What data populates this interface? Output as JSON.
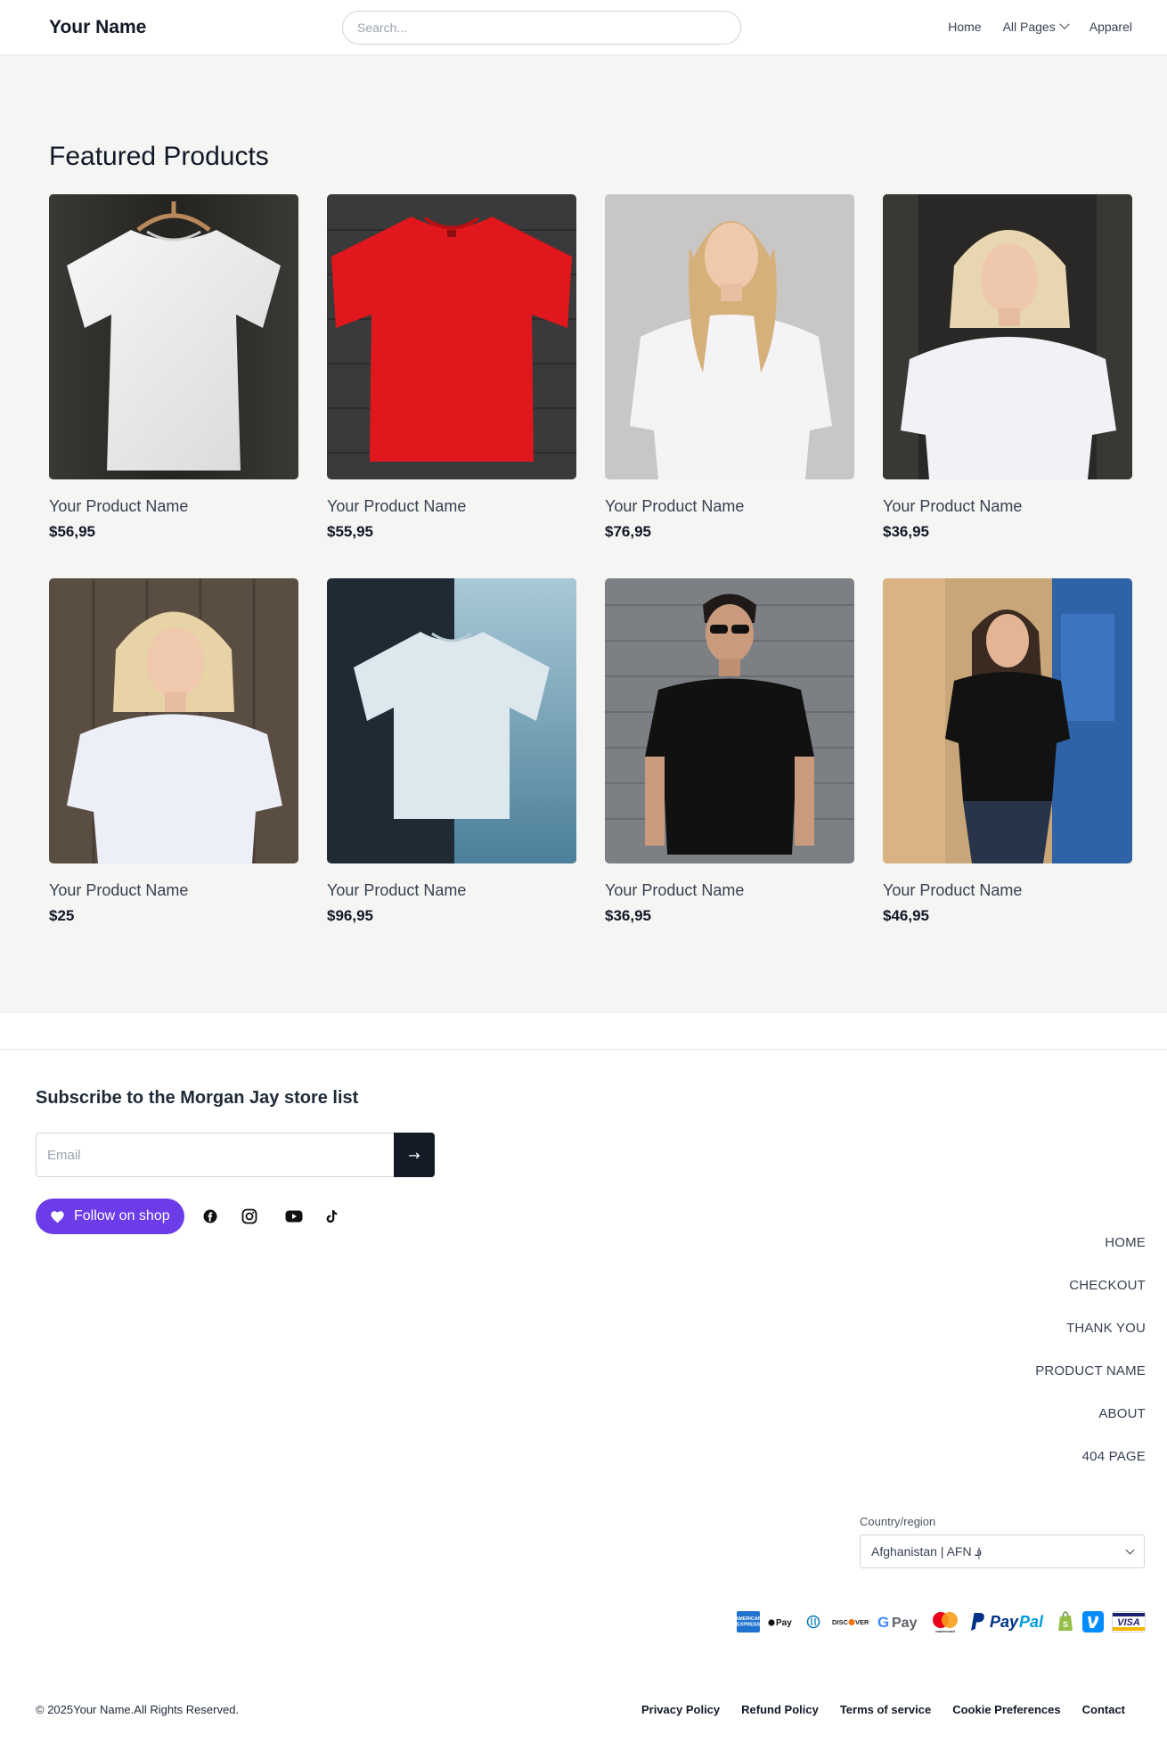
{
  "header": {
    "brand": "Your Name",
    "search_placeholder": "Search...",
    "nav": [
      {
        "label": "Home"
      },
      {
        "label": "All Pages"
      },
      {
        "label": "Apparel"
      }
    ]
  },
  "featured": {
    "title": "Featured Products",
    "products": [
      {
        "name": "Your Product Name",
        "price": "$56,95",
        "image": "white-tshirt-on-hanger"
      },
      {
        "name": "Your Product Name",
        "price": "$55,95",
        "image": "red-tshirt-flatlay"
      },
      {
        "name": "Your Product Name",
        "price": "$76,95",
        "image": "woman-white-tshirt"
      },
      {
        "name": "Your Product Name",
        "price": "$36,95",
        "image": "blonde-woman-white-tshirt"
      },
      {
        "name": "Your Product Name",
        "price": "$25",
        "image": "blonde-woman-white-tshirt-2"
      },
      {
        "name": "Your Product Name",
        "price": "$96,95",
        "image": "light-blue-tshirt-floating"
      },
      {
        "name": "Your Product Name",
        "price": "$36,95",
        "image": "man-black-tshirt-sunglasses"
      },
      {
        "name": "Your Product Name",
        "price": "$46,95",
        "image": "woman-black-tshirt-jeans"
      }
    ]
  },
  "footer": {
    "subscribe_title": "Subscribe to the Morgan Jay store list",
    "email_placeholder": "Email",
    "submit_symbol": "→",
    "follow_label": "Follow on shop",
    "socials": [
      "facebook-icon",
      "instagram-icon",
      "youtube-icon",
      "tiktok-icon"
    ],
    "nav": [
      {
        "label": "HOME"
      },
      {
        "label": "CHECKOUT"
      },
      {
        "label": "THANK YOU"
      },
      {
        "label": "PRODUCT NAME"
      },
      {
        "label": "ABOUT"
      },
      {
        "label": "404 PAGE"
      }
    ],
    "country_label": "Country/region",
    "country_value": "Afghanistan | AFN ؋",
    "payments": [
      "American Express",
      "Apple Pay",
      "Diners Club",
      "Discover",
      "Google Pay",
      "Mastercard",
      "PayPal",
      "Shop Pay",
      "Venmo",
      "Visa"
    ],
    "copyright": "© 2025Your Name.All Rights Reserved.",
    "legal": [
      {
        "label": "Privacy Policy"
      },
      {
        "label": "Refund Policy"
      },
      {
        "label": "Terms of service"
      },
      {
        "label": "Cookie Preferences"
      },
      {
        "label": "Contact"
      }
    ]
  },
  "colors": {
    "accent_purple": "#6c3ce9",
    "dark_button": "#141a26",
    "section_bg": "#f5f5f3"
  }
}
